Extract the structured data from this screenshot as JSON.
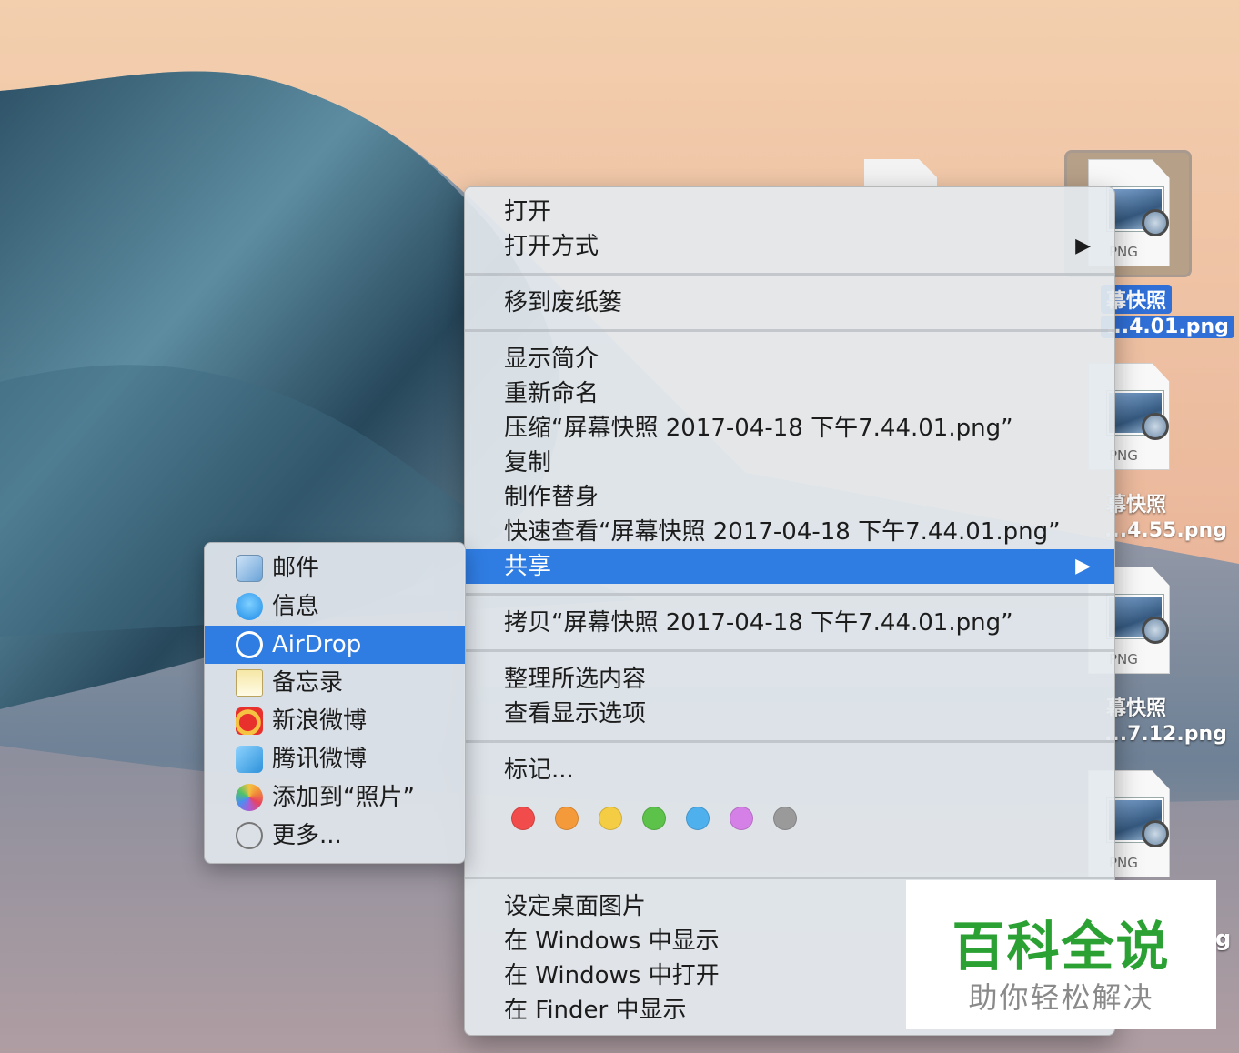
{
  "desktop": {
    "icons": [
      {
        "ext": "PNG",
        "line1": "幕快照",
        "line2": "...4.01.png",
        "selected": true
      },
      {
        "ext": "PNG",
        "line1": "幕快照",
        "line2": "...4.55.png",
        "selected": false
      },
      {
        "ext": "PNG",
        "line1": "幕快照",
        "line2": "...7.12.png",
        "selected": false
      },
      {
        "ext": "PNG",
        "line1": "",
        "line2": "g",
        "selected": false
      }
    ]
  },
  "context_menu": {
    "open": "打开",
    "open_with": "打开方式",
    "move_to_trash": "移到废纸篓",
    "get_info": "显示简介",
    "rename": "重新命名",
    "compress": "压缩“屏幕快照 2017-04-18 下午7.44.01.png”",
    "duplicate": "复制",
    "make_alias": "制作替身",
    "quick_look": "快速查看“屏幕快照 2017-04-18 下午7.44.01.png”",
    "share": "共享",
    "copy": "拷贝“屏幕快照 2017-04-18 下午7.44.01.png”",
    "clean_up": "整理所选内容",
    "view_options": "查看显示选项",
    "tags": "标记...",
    "tag_colors": [
      "#f24b4b",
      "#f59a3a",
      "#f4cd45",
      "#5cc24a",
      "#4fb0ee",
      "#d580e6",
      "#9a9a9a"
    ],
    "set_desktop_picture": "设定桌面图片",
    "show_in_windows": "在 Windows 中显示",
    "open_in_windows": "在 Windows 中打开",
    "show_in_finder": "在 Finder 中显示",
    "arrow": "▶"
  },
  "share_menu": {
    "items": [
      "邮件",
      "信息",
      "AirDrop",
      "备忘录",
      "新浪微博",
      "腾讯微博",
      "添加到“照片”",
      "更多..."
    ],
    "highlighted": "AirDrop"
  },
  "watermark": {
    "title": "百科全说",
    "subtitle": "助你轻松解决"
  },
  "colors": {
    "highlight": "#2f7de3",
    "selection_label": "#2f6fd6"
  }
}
